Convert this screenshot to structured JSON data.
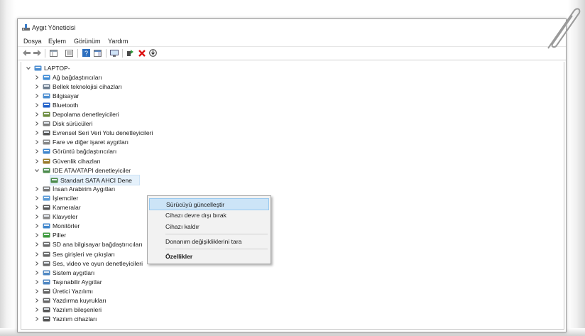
{
  "window": {
    "title": "Aygıt Yöneticisi"
  },
  "menubar": {
    "items": [
      "Dosya",
      "Eylem",
      "Görünüm",
      "Yardım"
    ]
  },
  "toolbar": {
    "buttons": [
      "back-icon",
      "forward-icon",
      "view-icon",
      "properties-icon",
      "help-icon",
      "view-pane-icon",
      "monitor-icon",
      "update-driver-icon",
      "uninstall-icon",
      "scan-icon"
    ]
  },
  "tree": {
    "root": "LAPTOP-",
    "categories": [
      {
        "label": "Ağ bağdaştırıcıları",
        "icon": "network-icon"
      },
      {
        "label": "Bellek teknolojisi cihazları",
        "icon": "memory-icon"
      },
      {
        "label": "Bilgisayar",
        "icon": "computer-icon"
      },
      {
        "label": "Bluetooth",
        "icon": "bluetooth-icon"
      },
      {
        "label": "Depolama denetleyicileri",
        "icon": "storage-icon"
      },
      {
        "label": "Disk sürücüleri",
        "icon": "disk-icon"
      },
      {
        "label": "Evrensel Seri Veri Yolu denetleyicileri",
        "icon": "usb-icon"
      },
      {
        "label": "Fare ve diğer işaret aygıtları",
        "icon": "mouse-icon"
      },
      {
        "label": "Görüntü bağdaştırıcıları",
        "icon": "display-icon"
      },
      {
        "label": "Güvenlik cihazları",
        "icon": "security-icon"
      },
      {
        "label": "IDE ATA/ATAPI denetleyiciler",
        "icon": "ide-icon",
        "expanded": true,
        "children": [
          {
            "label": "Standart SATA AHCI Dene",
            "icon": "ide-icon"
          }
        ]
      },
      {
        "label": "İnsan Arabirim Aygıtları",
        "icon": "hid-icon"
      },
      {
        "label": "İşlemciler",
        "icon": "cpu-icon"
      },
      {
        "label": "Kameralar",
        "icon": "camera-icon"
      },
      {
        "label": "Klavyeler",
        "icon": "keyboard-icon"
      },
      {
        "label": "Monitörler",
        "icon": "monitor-icon"
      },
      {
        "label": "Piller",
        "icon": "battery-icon"
      },
      {
        "label": "SD ana bilgisayar bağdaştırıcıları",
        "icon": "sd-icon"
      },
      {
        "label": "Ses girişleri ve çıkışları",
        "icon": "speaker-icon"
      },
      {
        "label": "Ses, video ve oyun denetleyicileri",
        "icon": "speaker-icon"
      },
      {
        "label": "Sistem aygıtları",
        "icon": "system-icon"
      },
      {
        "label": "Taşınabilir Aygıtlar",
        "icon": "portable-icon"
      },
      {
        "label": "Üretici Yazılımı",
        "icon": "firmware-icon"
      },
      {
        "label": "Yazdırma kuyrukları",
        "icon": "printer-icon"
      },
      {
        "label": "Yazılım bileşenleri",
        "icon": "software-icon"
      },
      {
        "label": "Yazılım cihazları",
        "icon": "software-icon"
      }
    ]
  },
  "context_menu": {
    "items": [
      {
        "label": "Sürücüyü güncelleştir",
        "highlighted": true
      },
      {
        "label": "Cihazı devre dışı bırak"
      },
      {
        "label": "Cihazı kaldır"
      },
      {
        "label": "Donanım değişikliklerini tara"
      },
      {
        "label": "Özellikler",
        "bold": true
      }
    ]
  },
  "colors": {
    "accent": "#cce4f7",
    "selection": "#e5f1fb",
    "window_border": "#9a9a9a"
  }
}
